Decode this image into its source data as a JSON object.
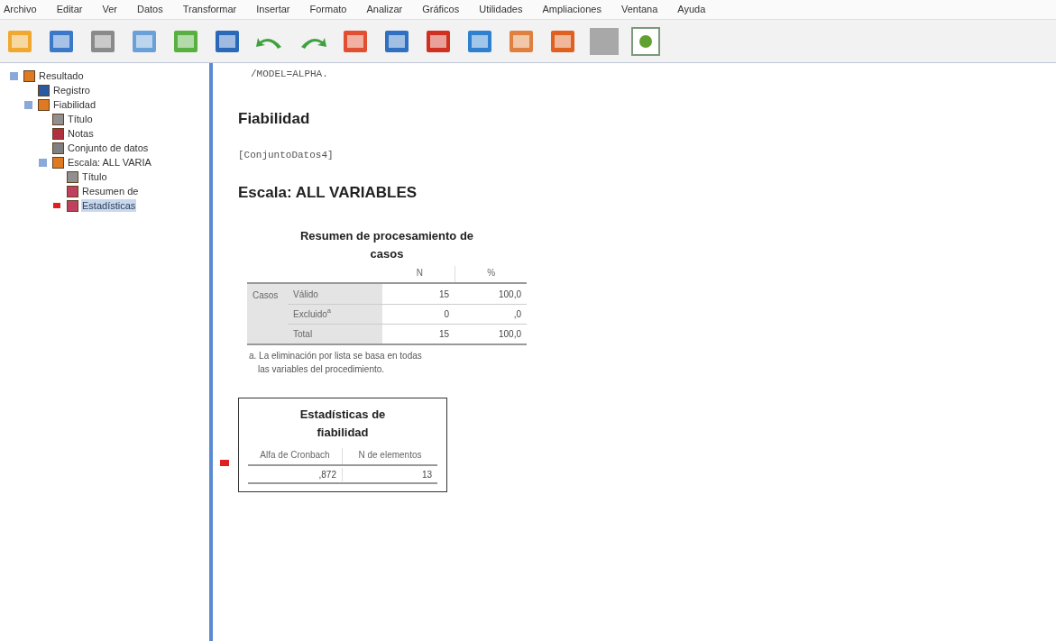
{
  "menu": [
    "Archivo",
    "Editar",
    "Ver",
    "Datos",
    "Transformar",
    "Insertar",
    "Formato",
    "Analizar",
    "Gráficos",
    "Utilidades",
    "Ampliaciones",
    "Ventana",
    "Ayuda"
  ],
  "toolbar": [
    {
      "kind": "open"
    },
    {
      "kind": "save"
    },
    {
      "kind": "print"
    },
    {
      "kind": "preview"
    },
    {
      "kind": "export"
    },
    {
      "kind": "data"
    },
    {
      "kind": "undo"
    },
    {
      "kind": "redo"
    },
    {
      "kind": "goto"
    },
    {
      "kind": "vars"
    },
    {
      "kind": "insert"
    },
    {
      "kind": "table"
    },
    {
      "kind": "edit"
    },
    {
      "kind": "chart"
    },
    {
      "kind": "disabled"
    },
    {
      "kind": "add"
    }
  ],
  "tree": [
    {
      "label": "Resultado",
      "kind": "book",
      "expanded": true,
      "selected": false,
      "children": [
        {
          "label": "Registro",
          "kind": "log",
          "selected": false
        },
        {
          "label": "Fiabilidad",
          "kind": "book",
          "expanded": true,
          "selected": false,
          "children": [
            {
              "label": "Título",
              "kind": "title",
              "selected": false
            },
            {
              "label": "Notas",
              "kind": "notes",
              "selected": false
            },
            {
              "label": "Conjunto de datos",
              "kind": "doc",
              "selected": false
            },
            {
              "label": "Escala: ALL VARIA",
              "kind": "book",
              "expanded": true,
              "selected": false,
              "children": [
                {
                  "label": "Título",
                  "kind": "title",
                  "selected": false
                },
                {
                  "label": "Resumen de",
                  "kind": "table",
                  "selected": false
                },
                {
                  "label": "Estadísticas",
                  "kind": "table",
                  "selected": true
                }
              ]
            }
          ]
        }
      ]
    }
  ],
  "output": {
    "syntax": "/MODEL=ALPHA.",
    "heading": "Fiabilidad",
    "dataset": "[ConjuntoDatos4]",
    "scale": "Escala: ALL VARIABLES",
    "summary": {
      "title": "Resumen de procesamiento de casos",
      "columns": [
        "N",
        "%"
      ],
      "group": "Casos",
      "rows": [
        {
          "label": "Válido",
          "n": "15",
          "pct": "100,0"
        },
        {
          "label": "Excluido$^{a}$",
          "n": "0",
          "pct": ",0"
        },
        {
          "label": "Total",
          "n": "15",
          "pct": "100,0"
        }
      ],
      "footnote": "a. La eliminación por lista se basa en todas las variables del procedimiento."
    },
    "reliability": {
      "title": "Estadísticas de fiabilidad",
      "selected": true,
      "columns": [
        "Alfa de Cronbach",
        "N de elementos"
      ],
      "values": [
        ",872",
        "13"
      ]
    }
  }
}
